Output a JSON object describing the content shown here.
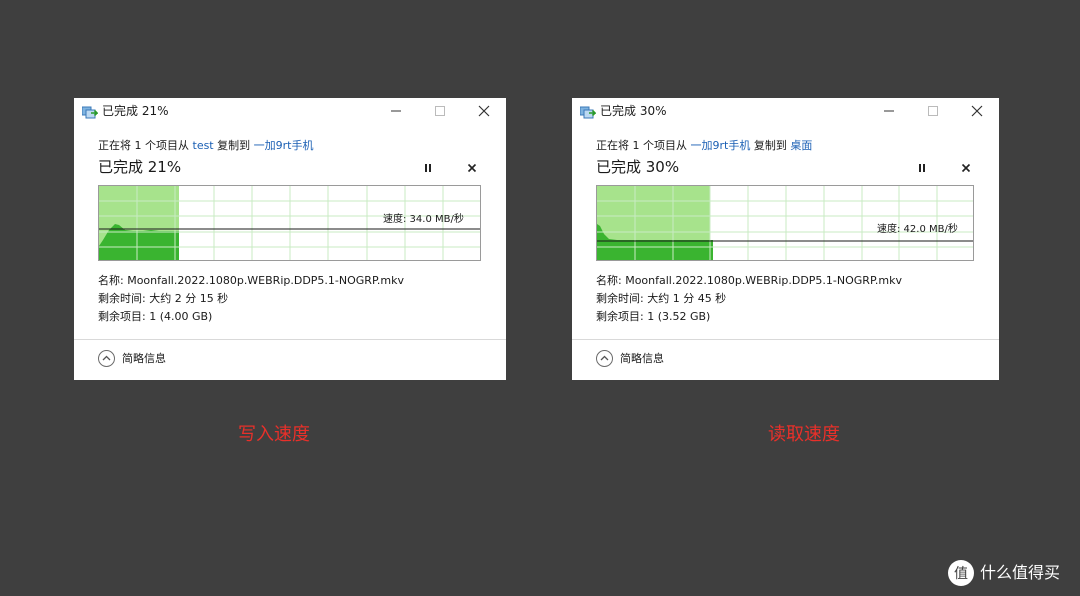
{
  "left_dialog": {
    "title": "已完成 21%",
    "copy_prefix": "正在将 1 个项目从",
    "source": "test",
    "copy_mid": "复制到",
    "destination": "一加9rt手机",
    "copy_suffix": "",
    "heading": "已完成 21%",
    "progress": 0.21,
    "speed_text": "速度: 34.0 MB/秒",
    "name_line": "名称:  Moonfall.2022.1080p.WEBRip.DDP5.1-NOGRP.mkv",
    "time_line": "剩余时间:  大约 2 分 15 秒",
    "items_line": "剩余项目:  1 (4.00 GB)",
    "details_label": "简略信息"
  },
  "right_dialog": {
    "title": "已完成 30%",
    "copy_prefix": "正在将 1 个项目从",
    "source": "一加9rt手机",
    "copy_mid": "复制到",
    "destination": "桌面",
    "copy_suffix": "",
    "heading": "已完成 30%",
    "progress": 0.3,
    "speed_text": "速度: 42.0 MB/秒",
    "name_line": "名称:  Moonfall.2022.1080p.WEBRip.DDP5.1-NOGRP.mkv",
    "time_line": "剩余时间:  大约 1 分 45 秒",
    "items_line": "剩余项目:  1 (3.52 GB)",
    "details_label": "简略信息"
  },
  "captions": {
    "left": "写入速度",
    "right": "读取速度"
  },
  "watermark": {
    "badge": "值",
    "text": "什么值得买"
  },
  "colors": {
    "background": "#3f3f3f",
    "caption": "#e8302a",
    "link": "#1a5fb4",
    "graph_fill_light": "#a7e38c",
    "graph_fill_dark": "#3ab430"
  }
}
